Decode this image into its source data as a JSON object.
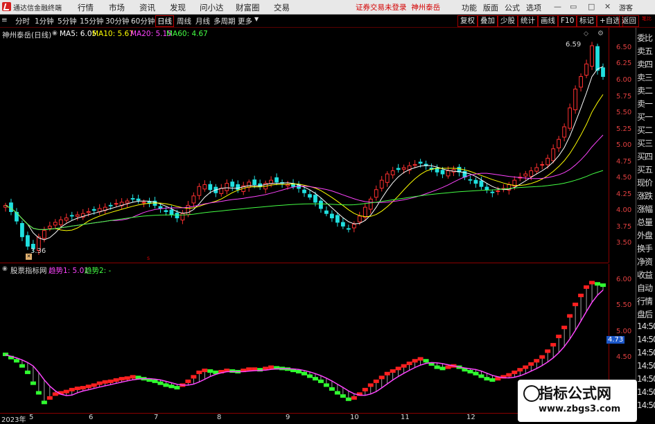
{
  "topbar": {
    "app_name": "通达信金融终端",
    "menu": [
      "行情",
      "市场",
      "资讯",
      "发现",
      "问小达",
      "财富圈",
      "交易"
    ],
    "warning": "证券交易未登录",
    "stock_tag": "神州泰岳",
    "right_buttons": [
      "功能",
      "版面",
      "公式",
      "选项"
    ],
    "guest": "游客"
  },
  "toolbar": {
    "periods": [
      "分时",
      "1分钟",
      "5分钟",
      "15分钟",
      "30分钟",
      "60分钟",
      "日线",
      "周线",
      "月线",
      "多周期",
      "更多"
    ],
    "active_period": "日线",
    "right_buttons": [
      "复权",
      "叠加",
      "少股",
      "统计",
      "画线",
      "F10",
      "标记",
      "+自选",
      "返回"
    ]
  },
  "main_chart": {
    "stock_name": "神州泰岳(日线)",
    "ma": [
      {
        "label": "MA5: 6.05",
        "color": "#ffffff"
      },
      {
        "label": "MA10: 5.67",
        "color": "#ffff00"
      },
      {
        "label": "MA20: 5.15",
        "color": "#ff44ff"
      },
      {
        "label": "MA60: 4.67",
        "color": "#44ff44"
      }
    ],
    "high_label": "6.59",
    "low_label": "3.36",
    "price_ticks": [
      "6.50",
      "6.25",
      "6.00",
      "5.75",
      "5.50",
      "5.25",
      "5.00",
      "4.75",
      "4.50",
      "4.25",
      "4.00",
      "3.75",
      "3.50"
    ]
  },
  "sub_chart": {
    "indicator_name": "股票指标网",
    "trend1": "趋势1: 5.01",
    "trend2": "趋势2: -",
    "ticks": [
      "6.00",
      "5.50",
      "5.00",
      "4.50"
    ],
    "current_value": "4.73"
  },
  "sidebar": {
    "top_label": "笔比",
    "items": [
      "委比",
      "卖五",
      "卖四",
      "卖三",
      "卖二",
      "卖一",
      "买一",
      "买二",
      "买三",
      "买四",
      "买五",
      "现价",
      "涨跌",
      "涨幅",
      "总量",
      "外盘",
      "换手",
      "净资",
      "收益",
      "自动",
      "行情",
      "盘后",
      "14:50",
      "14:50",
      "14:50",
      "14:50",
      "14:50",
      "14:50",
      "14:50"
    ]
  },
  "date_axis": {
    "year_label": "2023年",
    "months": [
      "5",
      "6",
      "7",
      "8",
      "9",
      "10",
      "11",
      "12"
    ]
  },
  "watermark": {
    "title": "指标公式网",
    "url": "www.zbgs3.com"
  },
  "colors": {
    "up": "#ff3030",
    "down": "#20e0e0",
    "bull": "#ff2020",
    "bear": "#30ff30",
    "grid_border": "#8b0000"
  },
  "chart_data": [
    {
      "type": "line",
      "title": "神州泰岳(日线)",
      "series": [
        {
          "name": "MA5",
          "value": 6.05
        },
        {
          "name": "MA10",
          "value": 5.67
        },
        {
          "name": "MA20",
          "value": 5.15
        },
        {
          "name": "MA60",
          "value": 4.67
        }
      ],
      "ylim": [
        3.36,
        6.59
      ],
      "x_labels": [
        "5",
        "6",
        "7",
        "8",
        "9",
        "10",
        "11",
        "12"
      ],
      "close": [
        4.05,
        3.95,
        3.8,
        3.55,
        3.4,
        3.36,
        3.55,
        3.65,
        3.72,
        3.78,
        3.82,
        3.85,
        3.88,
        3.9,
        3.92,
        3.95,
        3.97,
        4.0,
        4.02,
        4.05,
        4.08,
        4.1,
        4.12,
        4.15,
        4.13,
        4.1,
        4.08,
        4.05,
        4.0,
        3.95,
        3.9,
        3.85,
        3.92,
        4.05,
        4.2,
        4.35,
        4.38,
        4.3,
        4.25,
        4.32,
        4.4,
        4.35,
        4.3,
        4.36,
        4.42,
        4.38,
        4.35,
        4.4,
        4.45,
        4.42,
        4.4,
        4.38,
        4.35,
        4.32,
        4.25,
        4.18,
        4.1,
        4.0,
        3.92,
        3.85,
        3.78,
        3.72,
        3.68,
        3.75,
        3.88,
        4.02,
        4.15,
        4.3,
        4.45,
        4.55,
        4.6,
        4.62,
        4.65,
        4.68,
        4.7,
        4.72,
        4.68,
        4.62,
        4.58,
        4.55,
        4.6,
        4.62,
        4.58,
        4.5,
        4.45,
        4.4,
        4.35,
        4.3,
        4.25,
        4.28,
        4.32,
        4.38,
        4.45,
        4.5,
        4.55,
        4.6,
        4.65,
        4.7,
        4.8,
        4.95,
        5.1,
        5.3,
        5.6,
        5.9,
        6.1,
        6.3,
        6.59,
        6.2,
        6.1
      ]
    },
    {
      "type": "area",
      "title": "股票指标网",
      "series": [
        {
          "name": "趋势1",
          "value": 5.01
        },
        {
          "name": "趋势2"
        }
      ],
      "ylim": [
        4.2,
        6.2
      ],
      "trend": [
        5.0,
        4.95,
        4.9,
        4.82,
        4.72,
        4.55,
        4.4,
        4.25,
        4.32,
        4.38,
        4.4,
        4.42,
        4.45,
        4.47,
        4.48,
        4.5,
        4.52,
        4.55,
        4.57,
        4.58,
        4.6,
        4.62,
        4.63,
        4.65,
        4.64,
        4.62,
        4.6,
        4.58,
        4.55,
        4.52,
        4.5,
        4.48,
        4.52,
        4.58,
        4.65,
        4.72,
        4.75,
        4.74,
        4.72,
        4.73,
        4.75,
        4.74,
        4.73,
        4.75,
        4.77,
        4.77,
        4.76,
        4.78,
        4.8,
        4.79,
        4.78,
        4.77,
        4.75,
        4.73,
        4.7,
        4.66,
        4.62,
        4.58,
        4.52,
        4.46,
        4.4,
        4.35,
        4.3,
        4.32,
        4.38,
        4.45,
        4.52,
        4.58,
        4.64,
        4.7,
        4.74,
        4.78,
        4.82,
        4.86,
        4.9,
        4.93,
        4.9,
        4.85,
        4.8,
        4.78,
        4.8,
        4.82,
        4.8,
        4.76,
        4.73,
        4.7,
        4.66,
        4.62,
        4.6,
        4.62,
        4.65,
        4.68,
        4.72,
        4.76,
        4.8,
        4.85,
        4.9,
        4.96,
        5.05,
        5.15,
        5.28,
        5.42,
        5.6,
        5.78,
        5.92,
        6.05,
        6.12,
        6.1,
        6.08
      ]
    }
  ]
}
